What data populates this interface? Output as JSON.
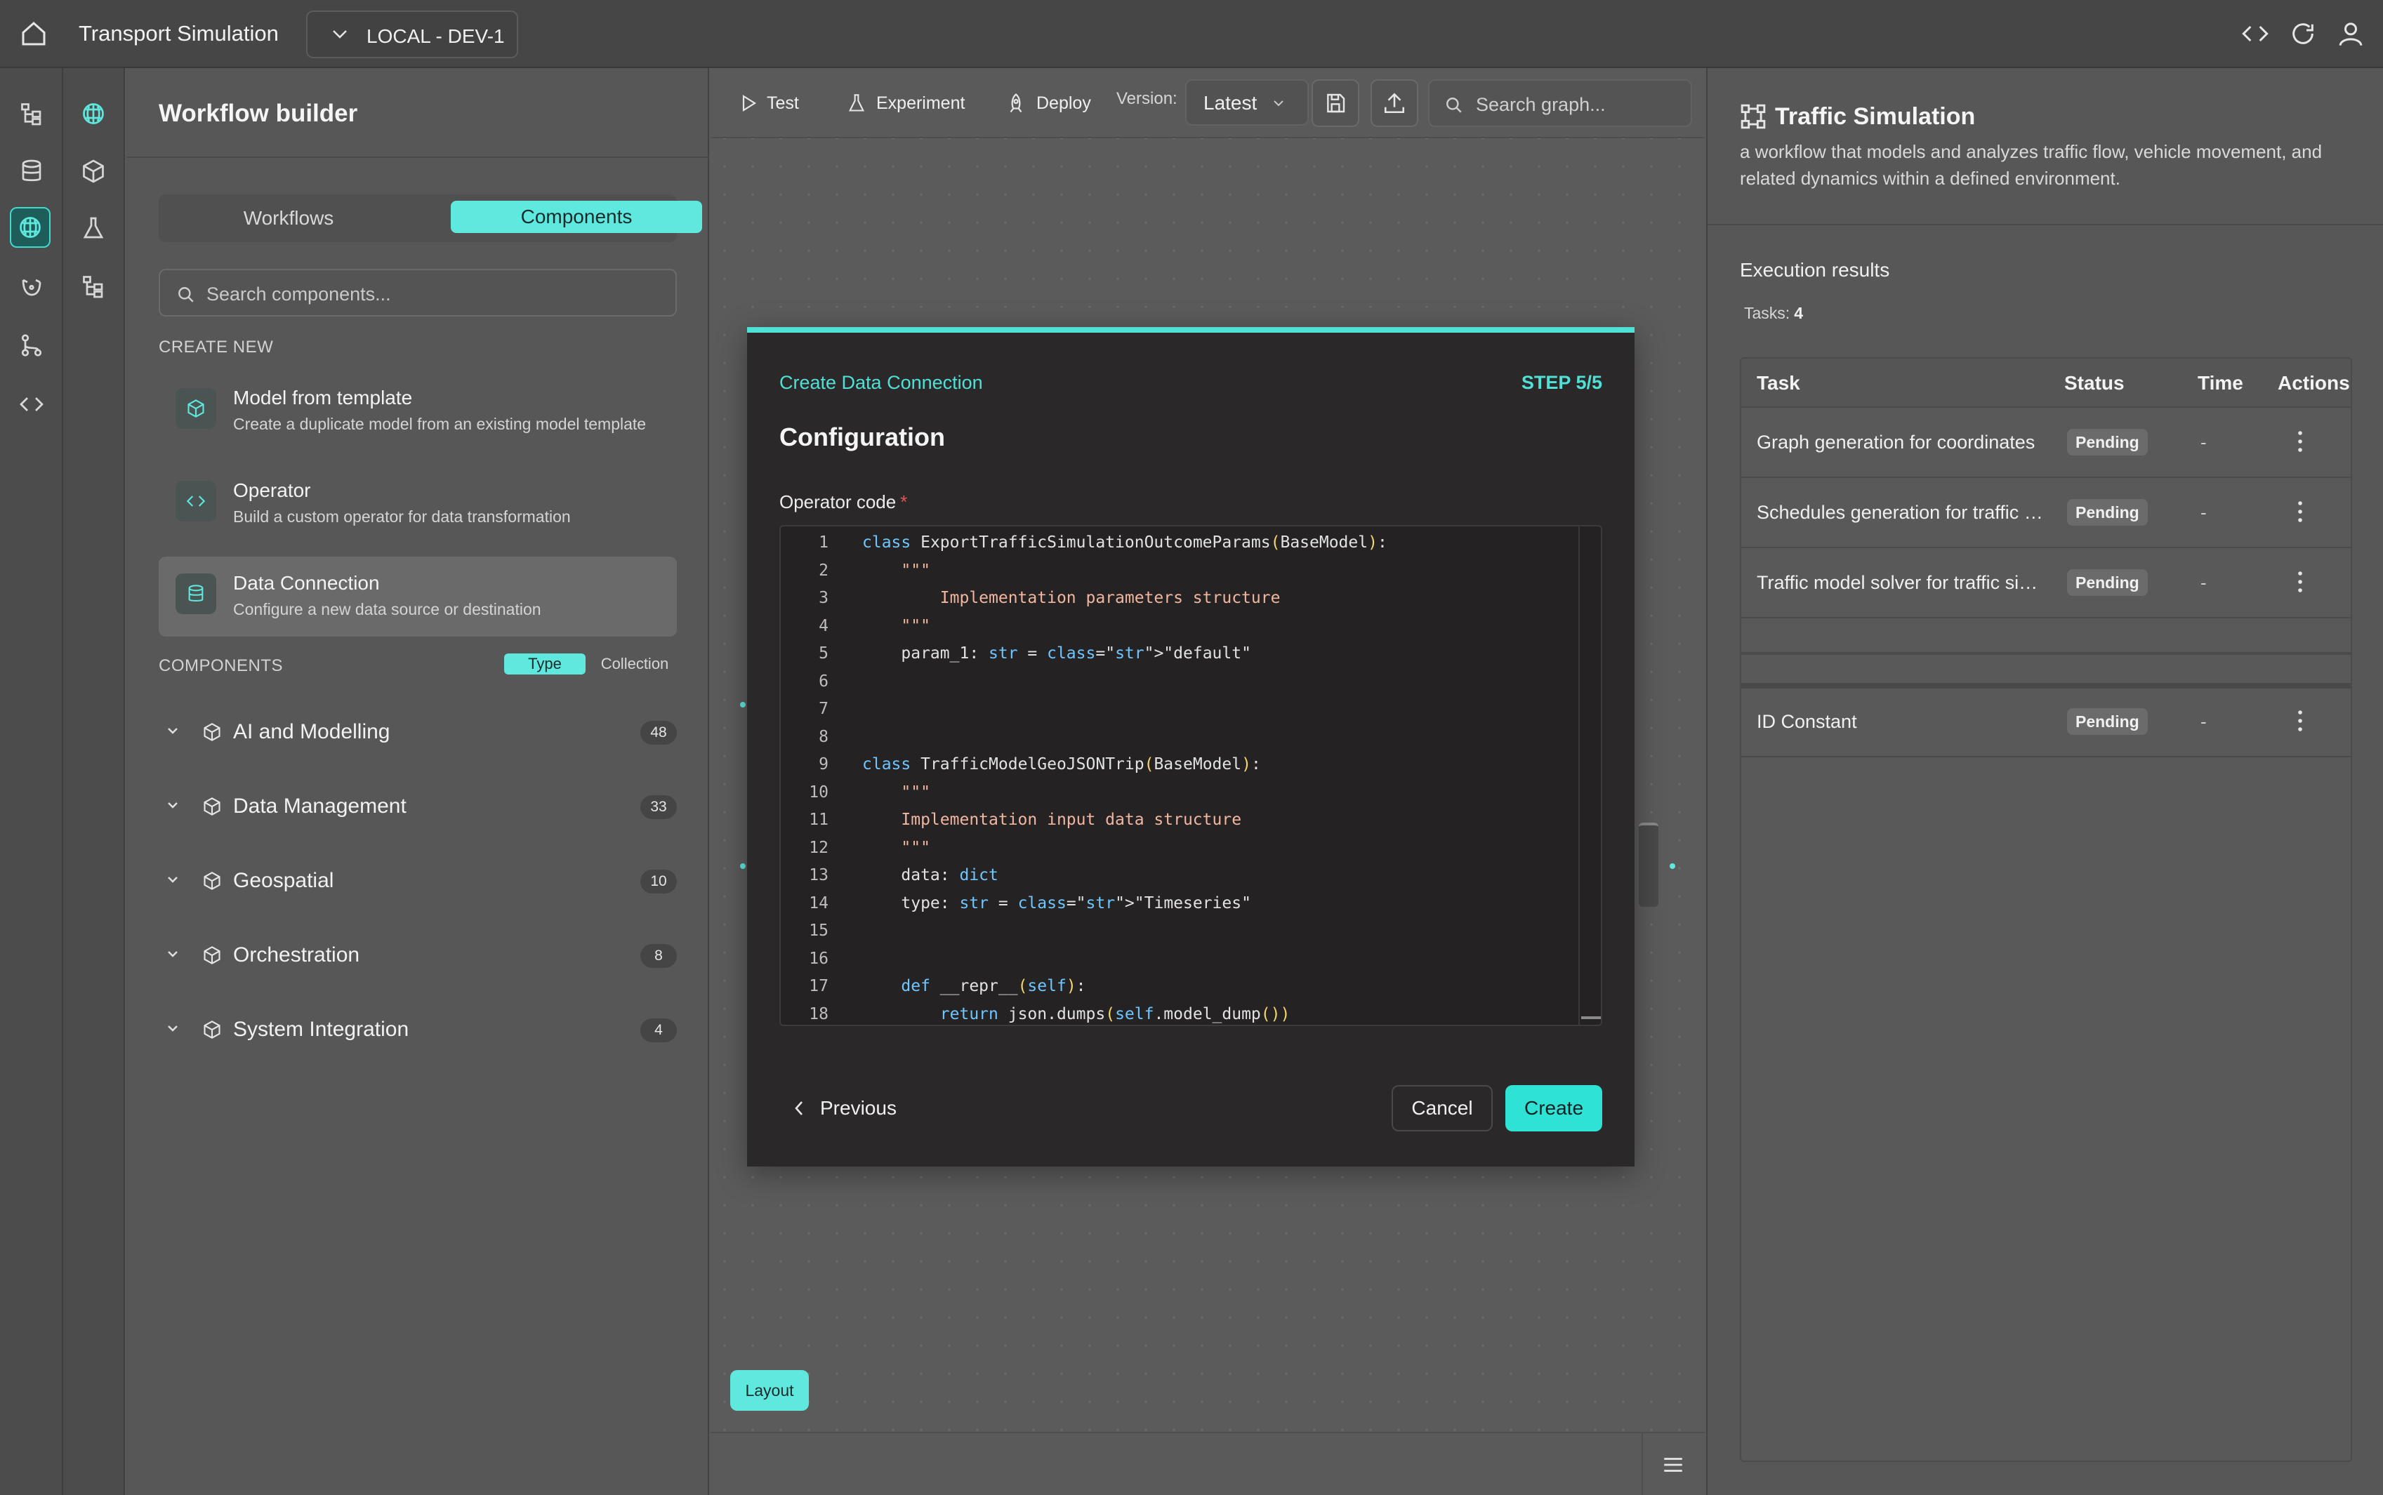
{
  "app": {
    "title": "Transport Simulation",
    "environment": "LOCAL - DEV-1"
  },
  "sidebar": {
    "title": "Workflow builder",
    "tabs": [
      {
        "label": "Workflows",
        "active": false
      },
      {
        "label": "Components",
        "active": true
      }
    ],
    "search_placeholder": "Search components...",
    "create_new_label": "CREATE NEW",
    "create_items": [
      {
        "title": "Model from template",
        "desc": "Create a duplicate model from an existing model template",
        "icon": "cube-icon"
      },
      {
        "title": "Operator",
        "desc": "Build a custom operator for data transformation",
        "icon": "code-icon"
      },
      {
        "title": "Data Connection",
        "desc": "Configure a new data source or destination",
        "icon": "database-icon"
      }
    ],
    "components_label": "COMPONENTS",
    "view_toggle": {
      "type": "Type",
      "collection": "Collection"
    },
    "categories": [
      {
        "name": "AI and Modelling",
        "count": "48"
      },
      {
        "name": "Data Management",
        "count": "33"
      },
      {
        "name": "Geospatial",
        "count": "10"
      },
      {
        "name": "Orchestration",
        "count": "8"
      },
      {
        "name": "System Integration",
        "count": "4"
      }
    ]
  },
  "toolbar": {
    "test": "Test",
    "experiment": "Experiment",
    "deploy": "Deploy",
    "version_label": "Version:",
    "version_value": "Latest",
    "search_placeholder": "Search graph..."
  },
  "canvas": {
    "layout_button": "Layout"
  },
  "modal": {
    "header_title": "Create Data Connection",
    "step": "STEP 5/5",
    "heading": "Configuration",
    "code_label": "Operator code",
    "required_mark": "*",
    "code_lines": [
      "class ExportTrafficSimulationOutcomeParams(BaseModel):",
      "    \"\"\"",
      "        Implementation parameters structure",
      "    \"\"\"",
      "    param_1: str = \"default\"",
      "",
      "",
      "",
      "class TrafficModelGeoJSONTrip(BaseModel):",
      "    \"\"\"",
      "    Implementation input data structure",
      "    \"\"\"",
      "    data: dict",
      "    type: str = \"Timeseries\"",
      "",
      "",
      "    def __repr__(self):",
      "        return json.dumps(self.model_dump())"
    ],
    "previous": "Previous",
    "cancel": "Cancel",
    "create": "Create"
  },
  "right_panel": {
    "title": "Traffic Simulation",
    "description": "a workflow that models and analyzes traffic flow, vehicle movement, and related dynamics within a defined environment.",
    "execution_title": "Execution results",
    "tasks_label": "Tasks:",
    "tasks_count": "4",
    "columns": [
      "Task",
      "Status",
      "Time",
      "Actions"
    ],
    "tasks": [
      {
        "name": "Graph generation for coordinates",
        "status": "Pending",
        "time": "-"
      },
      {
        "name": "Schedules generation for traffic s...",
        "status": "Pending",
        "time": "-"
      },
      {
        "name": "Traffic model solver for traffic sim...",
        "status": "Pending",
        "time": "-"
      },
      {
        "name": "ID Constant",
        "status": "Pending",
        "time": "-"
      }
    ]
  },
  "colors": {
    "accent": "#5ee8de",
    "modal_bg": "#2a2829",
    "panel_bg": "#585758"
  }
}
